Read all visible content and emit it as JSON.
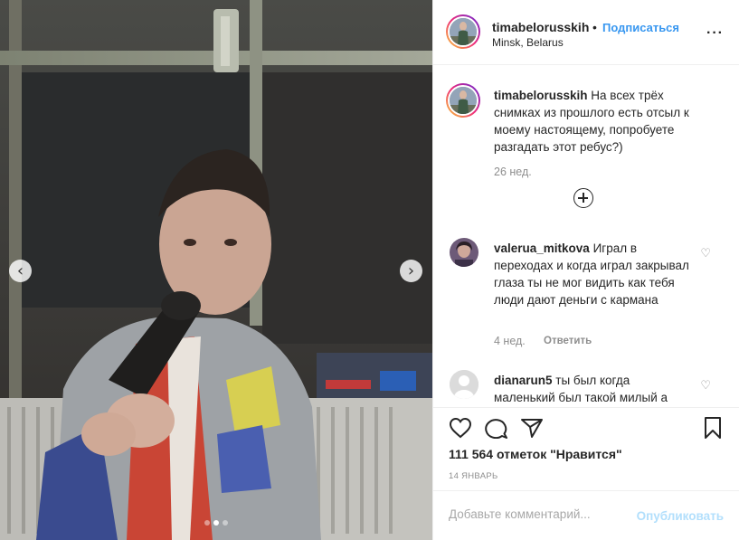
{
  "post": {
    "username": "timabelorusskih",
    "dot": "•",
    "follow_label": "Подписаться",
    "location": "Minsk, Belarus",
    "more_label": "···"
  },
  "caption": {
    "username": "timabelorusskih",
    "text": "На всех трёх снимках из прошлого есть отсыл к моему настоящему, попробуете разгадать этот ребус?)",
    "age": "26 нед."
  },
  "comments": [
    {
      "username": "valerua_mitkova",
      "text": "Играл в переходах и когда играл закрывал глаза ты не мог видить как тебя люди дают деньги с кармана",
      "age": "4 нед.",
      "reply_label": "Ответить"
    },
    {
      "username": "dianarun5",
      "text": "ты был когда маленький был такой милый а"
    }
  ],
  "likes": "111 564 отметок \"Нравится\"",
  "date": "14 ЯНВАРЬ",
  "add_comment": {
    "placeholder": "Добавьте комментарий...",
    "post_label": "Опубликовать"
  },
  "carousel": {
    "prev_label": "‹",
    "next_label": "›",
    "count": 3,
    "active_index": 1
  },
  "colors": {
    "accent": "#3897f0",
    "post_disabled": "#b2dffc",
    "muted": "#8e8e8e",
    "text": "#262626"
  }
}
